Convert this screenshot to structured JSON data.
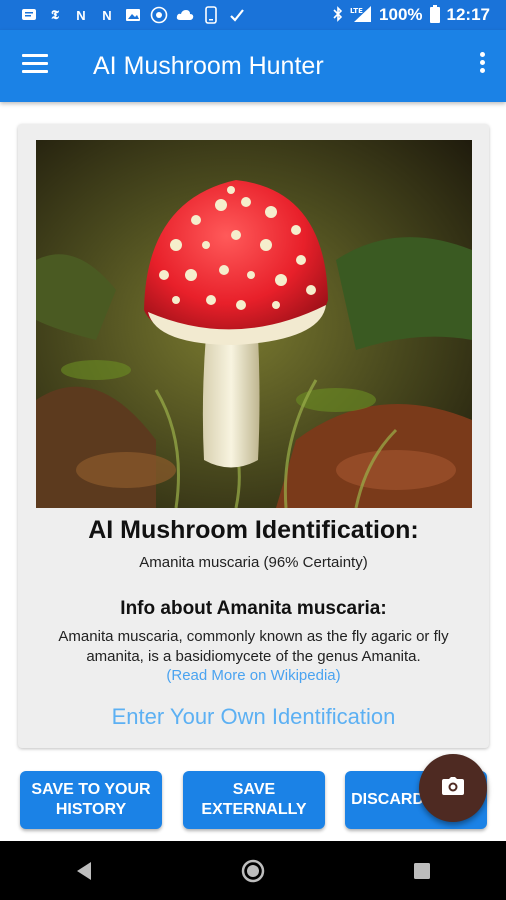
{
  "status_bar": {
    "battery": "100%",
    "time": "12:17",
    "notification_icons": [
      "message-icon",
      "news-icon",
      "n-icon",
      "n-icon",
      "image-icon",
      "badge-icon",
      "cloud-icon",
      "phone-icon",
      "check-icon"
    ]
  },
  "app_bar": {
    "title": "AI Mushroom Hunter"
  },
  "card": {
    "identification_title": "AI Mushroom Identification:",
    "identification_result": "Amanita muscaria (96% Certainty)",
    "info_title": "Info about Amanita muscaria:",
    "info_text": "Amanita muscaria, commonly known as the fly agaric or fly amanita, is a basidiomycete of the genus Amanita.",
    "wiki_link": "(Read More on Wikipedia)",
    "own_identification_link": "Enter Your Own Identification"
  },
  "buttons": {
    "save_history": "SAVE TO YOUR HISTORY",
    "save_externally": "SAVE EXTERNALLY",
    "discard": "DISCARD IMAGE"
  },
  "colors": {
    "primary": "#1b82e6",
    "status_bar": "#1a73d9",
    "link": "#4aa3f0",
    "fab": "#4e2a22"
  }
}
